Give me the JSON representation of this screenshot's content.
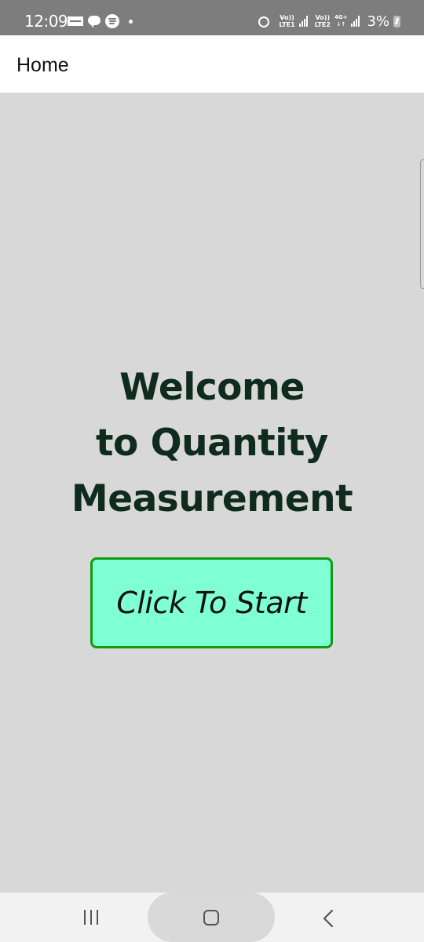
{
  "status_bar": {
    "time": "12:09",
    "notification_icons": [
      "news-icon",
      "chat-icon",
      "spotify-icon",
      "dot-icon"
    ],
    "system_icons": [
      "alarm-icon",
      "signal-icon",
      "signal-icon",
      "battery-icon"
    ],
    "sim1_label_top": "Vo))",
    "sim1_label_bottom": "LTE1",
    "sim2_label_top": "Vo))",
    "sim2_label_bottom": "LTE2",
    "network_type": "4G+",
    "network_arrows": "↓↑",
    "battery_percent": "3%"
  },
  "app_bar": {
    "title": "Home"
  },
  "main": {
    "welcome_line_1": "Welcome",
    "welcome_line_2": "to Quantity",
    "welcome_line_3": "Measurement",
    "start_button_label": "Click To Start"
  },
  "nav_bar": {
    "buttons": [
      "recent-apps-icon",
      "home-icon",
      "back-icon"
    ]
  },
  "colors": {
    "status_bar_bg": "#7d7d7d",
    "app_bar_bg": "#ffffff",
    "content_bg": "#d8d8d8",
    "heading_text": "#0f2a1f",
    "button_bg": "#7fffd4",
    "button_border": "#119a11",
    "nav_bar_bg": "#f2f2f2"
  }
}
